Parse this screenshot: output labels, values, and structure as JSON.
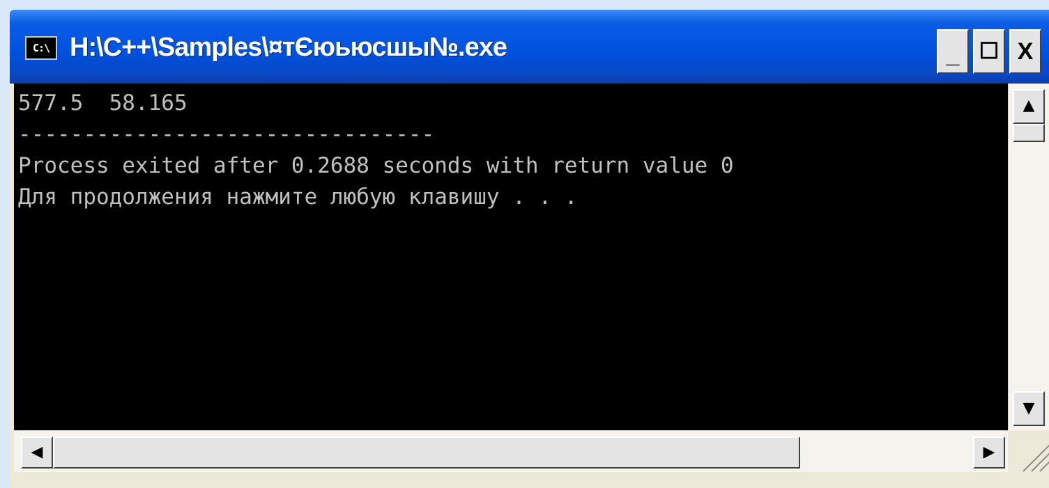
{
  "window": {
    "title": "H:\\C++\\Samples\\¤тЄюьюсшы№.exe",
    "app_icon_label": "C:\\",
    "buttons": {
      "minimize_label": "_",
      "maximize_label": "☐",
      "close_label": "X"
    }
  },
  "console": {
    "lines": [
      "577.5  58.165",
      "--------------------------------",
      "Process exited after 0.2688 seconds with return value 0",
      "Для продолжения нажмите любую клавишу . . ."
    ],
    "background_color": "#000000",
    "text_color": "#c0c0c0"
  },
  "scrollbars": {
    "vertical": {
      "up_icon": "arrow-up-icon",
      "up_glyph": "▲",
      "down_icon": "arrow-down-icon",
      "down_glyph": "▼"
    },
    "horizontal": {
      "left_icon": "arrow-left-icon",
      "left_glyph": "◀",
      "right_icon": "arrow-right-icon",
      "right_glyph": "▶"
    }
  },
  "colors": {
    "titlebar": "#0052e0",
    "window_frame": "#ece9d8",
    "desktop": "#d9e9fb"
  }
}
